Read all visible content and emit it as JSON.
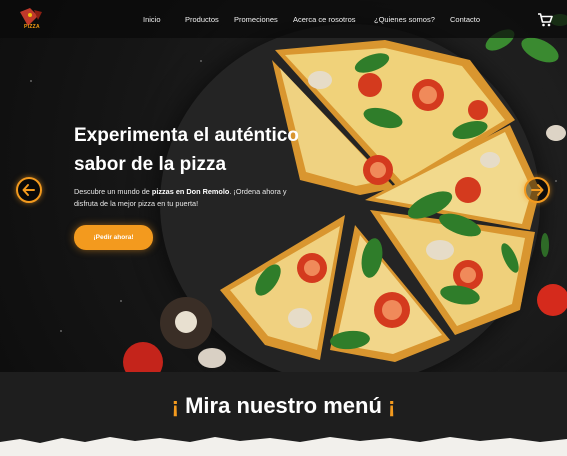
{
  "brand": {
    "logo_text": "PIZZA"
  },
  "nav": {
    "links": [
      "Inicio",
      "Productos",
      "Promeciones",
      "Acerca ce rosotros",
      "¿Quienes somos?",
      "Contacto"
    ]
  },
  "hero": {
    "headline_line1": "Experimenta el auténtico",
    "headline_line2": "sabor de la pizza",
    "desc_part1": "Descubre un mundo de ",
    "desc_bold": "pizzas en Don Remolo",
    "desc_part2": ". ¡Ordena ahora y disfruta de la mejor pizza en tu puerta!",
    "cta_label": "¡Pedir ahora!"
  },
  "menu_section": {
    "open_mark": "¡",
    "title": "Mira nuestro menú",
    "close_mark": "¡"
  },
  "colors": {
    "accent": "#f39a1e",
    "background": "#1c1c1c",
    "navbar": "#0a0a0a"
  },
  "icons": {
    "logo": "pizza-logo-icon",
    "cart": "shopping-cart-icon",
    "prev": "arrow-left-icon",
    "next": "arrow-right-icon"
  }
}
